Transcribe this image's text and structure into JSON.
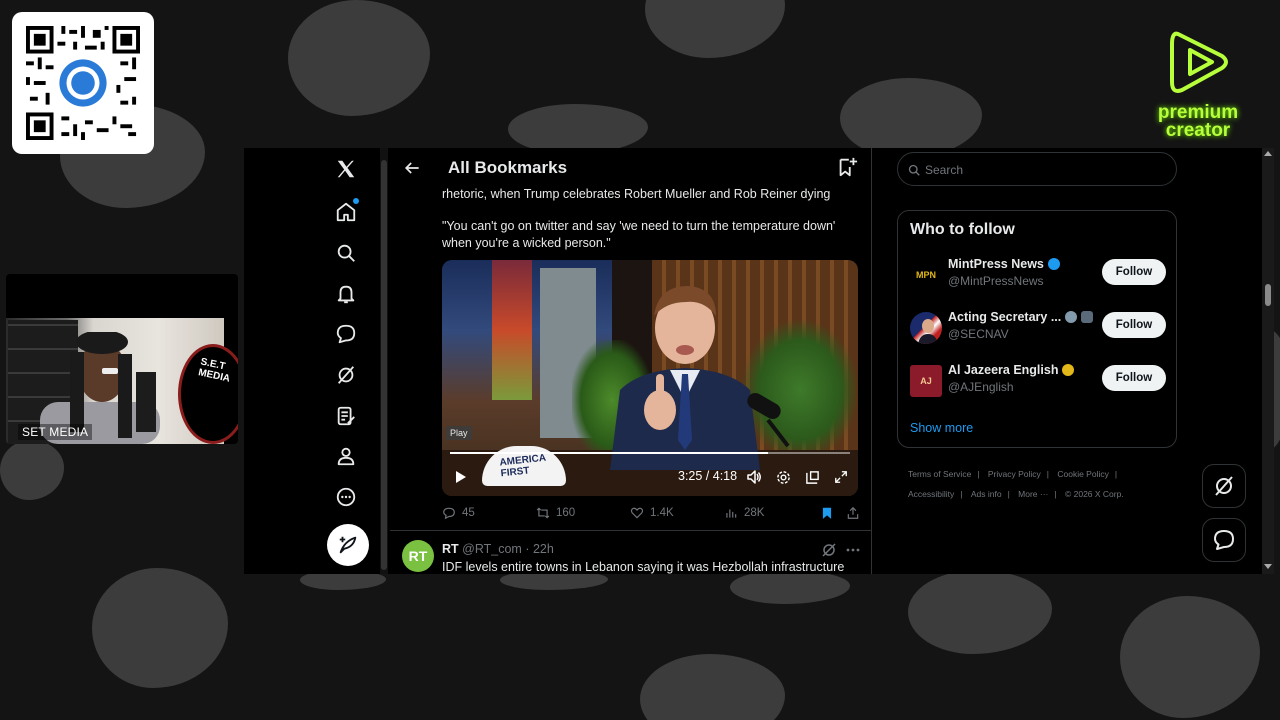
{
  "overlay": {
    "camera_label": "SET MEDIA",
    "camera_logo_text": "S.E.T MEDIA",
    "premium_line1": "premium",
    "premium_line2": "creator",
    "colors": {
      "premium_green": "#b6ff3a",
      "background": "#141414",
      "blob": "#3c3c3c"
    }
  },
  "left_nav": {
    "items": [
      {
        "icon": "x-logo-icon"
      },
      {
        "icon": "home-icon"
      },
      {
        "icon": "search-icon"
      },
      {
        "icon": "bell-icon"
      },
      {
        "icon": "messages-icon"
      },
      {
        "icon": "grok-icon"
      },
      {
        "icon": "lists-icon"
      },
      {
        "icon": "profile-icon"
      },
      {
        "icon": "more-icon"
      }
    ],
    "post_icon": "post-feather-icon"
  },
  "header": {
    "title": "All Bookmarks",
    "back_icon": "arrow-left-icon",
    "add_icon": "add-folder-icon"
  },
  "tweet": {
    "line1": "rhetoric, when Trump celebrates Robert Mueller and Rob Reiner dying",
    "line2": "\"You can't go on twitter and say 'we need to turn the temperature down'",
    "line3": "when you're a wicked person.\"",
    "video": {
      "play_label": "Play",
      "time": "3:25 / 4:18",
      "progress": 0.794,
      "hat_text": "AMERICA FIRST"
    },
    "actions": {
      "replies": "45",
      "reposts": "160",
      "likes": "1.4K",
      "views": "28K"
    }
  },
  "next_tweet": {
    "avatar_text": "RT",
    "name": "RT",
    "handle_time": "@RT_com · 22h",
    "text": "IDF levels entire towns in Lebanon saying it was Hezbollah infrastructure"
  },
  "right": {
    "search_placeholder": "Search",
    "who_to_follow_title": "Who to follow",
    "suggestions": [
      {
        "name": "MintPress News",
        "handle": "@MintPressNews",
        "avatar": "MPN",
        "badge": "#1d9bf0",
        "follow": "Follow"
      },
      {
        "name": "Acting Secretary ...",
        "handle": "@SECNAV",
        "avatar": "",
        "badge": "#829aab",
        "follow": "Follow"
      },
      {
        "name": "Al Jazeera English",
        "handle": "@AJEnglish",
        "avatar": "AJ",
        "badge": "#e2b719",
        "follow": "Follow"
      }
    ],
    "show_more": "Show more",
    "footer": {
      "terms": "Terms of Service",
      "privacy": "Privacy Policy",
      "cookie": "Cookie Policy",
      "accessibility": "Accessibility",
      "ads": "Ads info",
      "more": "More ···",
      "copyright": "© 2026 X Corp."
    }
  }
}
